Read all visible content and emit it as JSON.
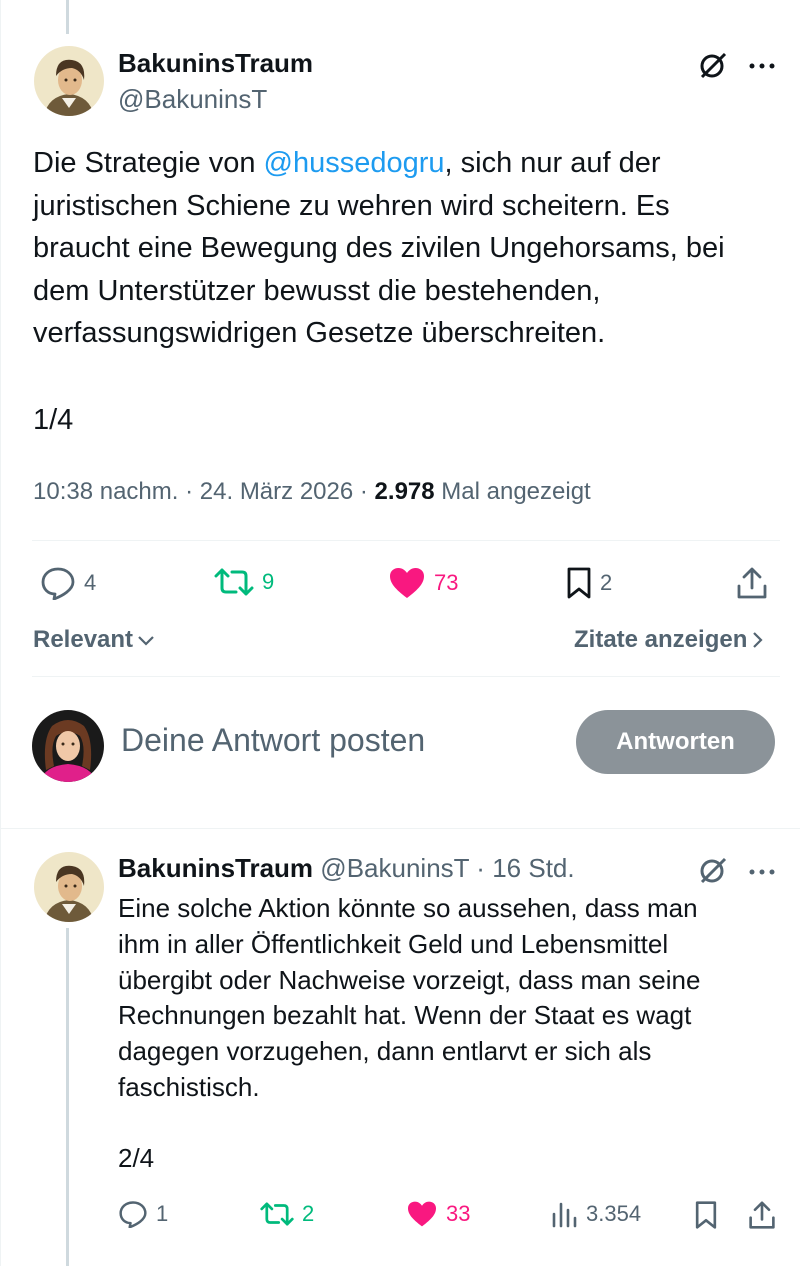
{
  "main_tweet": {
    "author_name": "BakuninsTraum",
    "author_handle": "@BakuninsT",
    "text_before_mention": "Die Strategie von ",
    "mention": "@hussedogru",
    "text_line1_rest": ", sich nur auf der",
    "text_line2": "juristischen Schiene zu wehren wird scheitern. Es",
    "text_line3": "braucht eine Bewegung des zivilen Ungehorsams, bei",
    "text_line4": "dem Unterstützer bewusst die bestehenden,",
    "text_line5": "verfassungswidrigen Gesetze überschreiten.",
    "thread_counter": "1/4",
    "time": "10:38 nachm.",
    "date": "24. März 2026",
    "views_count": "2.978",
    "views_label": "Mal angezeigt",
    "separator": "·",
    "replies": "4",
    "retweets": "9",
    "likes": "73",
    "bookmarks": "2",
    "icons": [
      "grok-icon",
      "more-icon",
      "reply-icon",
      "retweet-icon",
      "heart-icon",
      "bookmark-icon",
      "share-icon"
    ]
  },
  "tabs": {
    "sort_label": "Relevant",
    "quotes_label": "Zitate anzeigen"
  },
  "composer": {
    "placeholder": "Deine Antwort posten",
    "button_label": "Antworten"
  },
  "reply_tweet": {
    "author_name": "BakuninsTraum",
    "author_handle": "@BakuninsT",
    "time_ago": "16 Std.",
    "separator": "·",
    "lines": [
      "Eine solche Aktion könnte so aussehen, dass man",
      "ihm in aller Öffentlichkeit Geld und Lebensmittel",
      "übergibt oder Nachweise vorzeigt, dass man seine",
      "Rechnungen bezahlt hat. Wenn der Staat es wagt",
      "dagegen vorzugehen, dann entlarvt er sich als",
      "faschistisch."
    ],
    "thread_counter": "2/4",
    "replies": "1",
    "retweets": "2",
    "likes": "33",
    "views": "3.354"
  },
  "colors": {
    "accent": "#1d9bf0",
    "retweet_green": "#00ba7c",
    "like_pink": "#f91880",
    "muted": "#536471",
    "button_disabled": "#8b9399"
  }
}
